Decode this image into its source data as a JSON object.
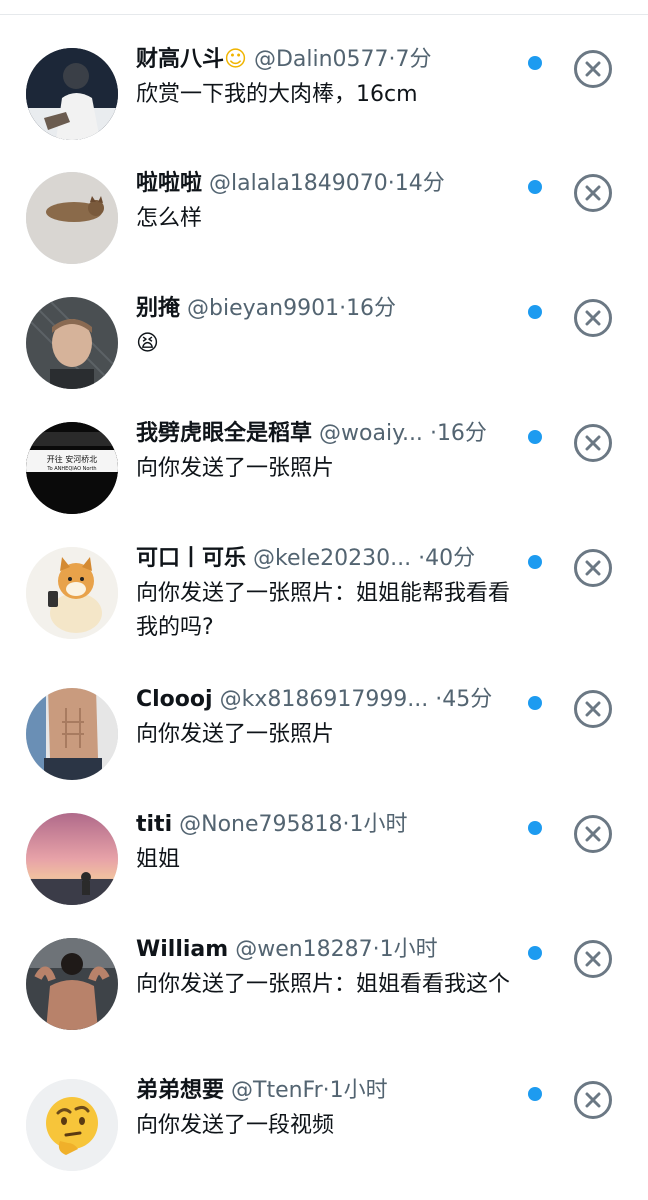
{
  "requests": [
    {
      "name": "财高八斗",
      "emoji": "☺",
      "handle": "@Dalin0577",
      "sep": "·",
      "time": "7分",
      "message": "欣赏一下我的大肉棒，16cm",
      "avatar_icon": "person-photo-avatar"
    },
    {
      "name": "啦啦啦",
      "emoji": "",
      "handle": "@lalala1849070",
      "sep": "·",
      "time": "14分",
      "message": "怎么样",
      "avatar_icon": "cat-photo-avatar"
    },
    {
      "name": "别掩",
      "emoji": "",
      "handle": "@bieyan9901",
      "sep": "·",
      "time": "16分",
      "message": "😫",
      "avatar_icon": "man-portrait-avatar"
    },
    {
      "name": "我劈虎眼全是稻草",
      "emoji": "",
      "handle": "@woaiy...",
      "sep": "·",
      "time": "16分",
      "message": "向你发送了一张照片",
      "avatar_icon": "subway-sign-avatar",
      "avatar_text": "开往 安河桥北",
      "avatar_subtext": "To ANHEQIAO North"
    },
    {
      "name": "可口丨可乐",
      "emoji": "",
      "handle": "@kele20230...",
      "sep": "·",
      "time": "40分",
      "message": "向你发送了一张照片：姐姐能帮我看看我的吗?",
      "avatar_icon": "shiba-dog-avatar"
    },
    {
      "name": "Clooоj",
      "emoji": "",
      "handle": "@kx8186917999...",
      "sep": "·",
      "time": "45分",
      "message": "向你发送了一张照片",
      "avatar_icon": "torso-photo-avatar"
    },
    {
      "name": "titi",
      "emoji": "",
      "handle": "@None795818",
      "sep": "·",
      "time": "1小时",
      "message": "姐姐",
      "avatar_icon": "sunset-photo-avatar"
    },
    {
      "name": "William",
      "emoji": "",
      "handle": "@wen18287",
      "sep": "·",
      "time": "1小时",
      "message": "向你发送了一张照片：姐姐看看我这个",
      "avatar_icon": "gym-photo-avatar"
    },
    {
      "name": "弟弟想要",
      "emoji": "",
      "handle": "@TtenFr",
      "sep": "·",
      "time": "1小时",
      "message": "向你发送了一段视频",
      "avatar_icon": "thinking-face-avatar"
    }
  ],
  "colors": {
    "unread_dot": "#1d9bf0",
    "close_icon": "#6b7884",
    "secondary_text": "#536471"
  }
}
